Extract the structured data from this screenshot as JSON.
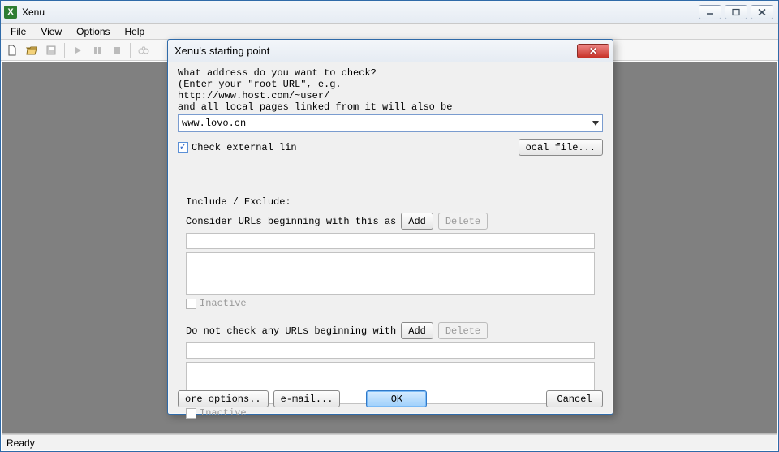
{
  "window": {
    "title": "Xenu"
  },
  "menu": {
    "file": "File",
    "view": "View",
    "options": "Options",
    "help": "Help"
  },
  "status": "Ready",
  "dialog": {
    "title": "Xenu's starting point",
    "intro": "What address do you want to check?\n(Enter your \"root URL\", e.g.\nhttp://www.host.com/~user/\nand all local pages linked from it will also be",
    "url_value": "www.lovo.cn",
    "check_external_label": "Check external lin",
    "local_file_label": "ocal file...",
    "section_title": "Include / Exclude:",
    "include_label": "Consider URLs beginning with this as",
    "exclude_label": "Do not check any URLs beginning with",
    "add_label": "Add",
    "delete_label": "Delete",
    "inactive_label": "Inactive",
    "more_options_label": "ore options..",
    "email_label": "e-mail...",
    "ok_label": "OK",
    "cancel_label": "Cancel"
  }
}
